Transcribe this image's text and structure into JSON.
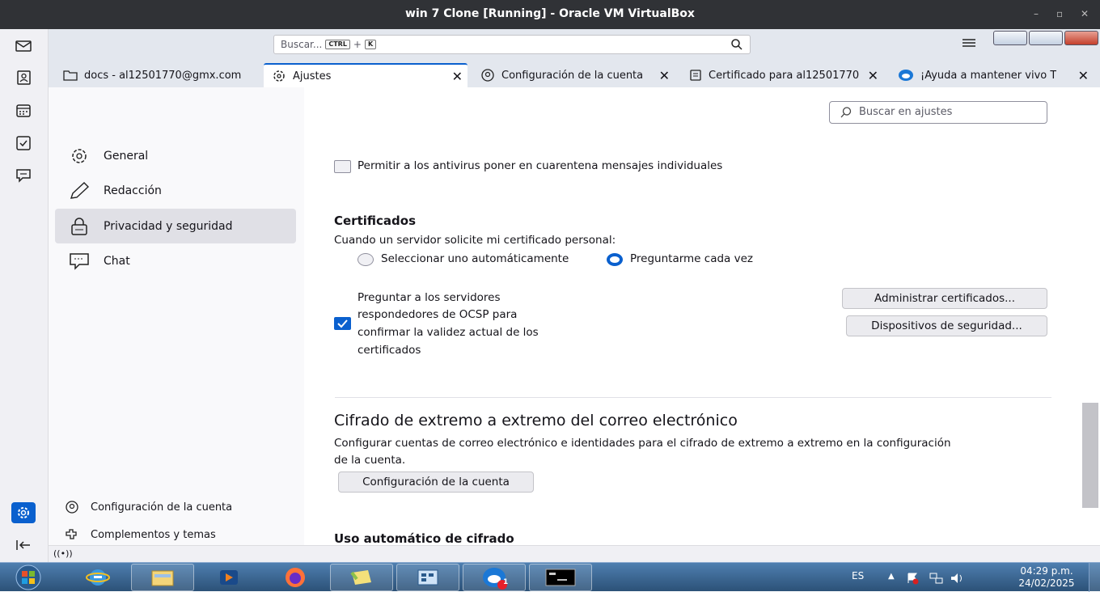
{
  "host": {
    "title": "win 7 Clone [Running] - Oracle VM VirtualBox"
  },
  "toolbar": {
    "search_placeholder": "Buscar...",
    "shortcut_key1": "CTRL",
    "shortcut_plus": "+",
    "shortcut_key2": "K"
  },
  "tabs": [
    {
      "label": "docs - al12501770@gmx.com",
      "icon": "folder-icon"
    },
    {
      "label": "Ajustes",
      "icon": "gear-icon"
    },
    {
      "label": "Configuración de la cuenta",
      "icon": "account-icon"
    },
    {
      "label": "Certificado para al12501770",
      "icon": "certificate-icon"
    },
    {
      "label": "¡Ayuda a mantener vivo T",
      "icon": "thunderbird-icon"
    }
  ],
  "settings_nav": {
    "items": [
      {
        "label": "General",
        "icon": "gear-icon"
      },
      {
        "label": "Redacción",
        "icon": "pencil-icon"
      },
      {
        "label": "Privacidad y seguridad",
        "icon": "lock-icon"
      },
      {
        "label": "Chat",
        "icon": "chat-icon"
      }
    ],
    "footer": [
      {
        "label": "Configuración de la cuenta",
        "icon": "account-icon"
      },
      {
        "label": "Complementos y temas",
        "icon": "puzzle-icon"
      }
    ]
  },
  "settings": {
    "search_placeholder": "Buscar en ajustes",
    "antivirus_label": "Permitir a los antivirus poner en cuarentena mensajes individuales",
    "certificates": {
      "heading": "Certificados",
      "prompt": "Cuando un servidor solicite mi certificado personal:",
      "radio_auto": "Seleccionar uno automáticamente",
      "radio_ask": "Preguntarme cada vez",
      "ocsp_line1": "Preguntar a los servidores",
      "ocsp_line2": "respondedores de OCSP para",
      "ocsp_line3": "confirmar la validez actual de los",
      "ocsp_line4": "certificados",
      "manage_button": "Administrar certificados...",
      "devices_button": "Dispositivos de seguridad..."
    },
    "e2e": {
      "heading": "Cifrado de extremo a extremo del correo electrónico",
      "desc_line1": "Configurar cuentas de correo electrónico e identidades para el cifrado de extremo a extremo en la configuración",
      "desc_line2": "de la cuenta.",
      "button": "Configuración de la cuenta"
    },
    "auto_encryption_heading": "Uso automático de cifrado"
  },
  "statusbar": {
    "icon": "((•))"
  },
  "taskbar": {
    "lang": "ES",
    "time": "04:29 p.m.",
    "date": "24/02/2025",
    "badge": "1"
  },
  "colors": {
    "accent": "#0a60ce",
    "taskbar": "#3b6796",
    "host_titlebar": "#303236"
  }
}
